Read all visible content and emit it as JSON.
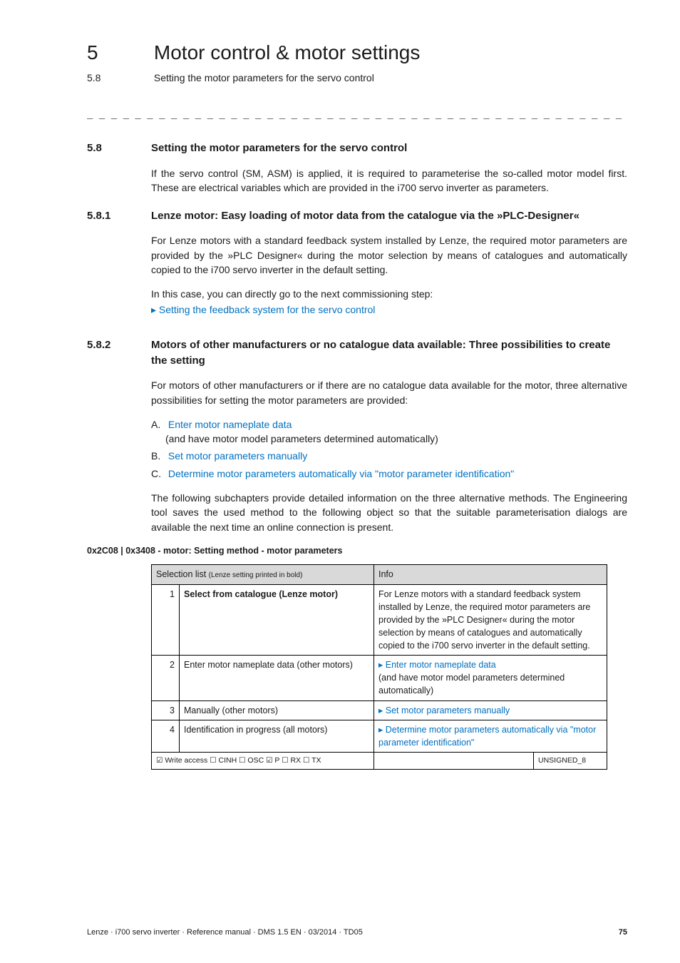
{
  "header": {
    "chapter_num": "5",
    "chapter_title": "Motor control & motor settings",
    "section_num": "5.8",
    "section_title": "Setting the motor parameters for the servo control"
  },
  "rule": "_ _ _ _ _ _ _ _ _ _ _ _ _ _ _ _ _ _ _ _ _ _ _ _ _ _ _ _ _ _ _ _ _ _ _ _ _ _ _ _ _ _ _ _ _ _ _ _ _ _ _ _ _ _ _ _ _ _ _ _ _ _ _ _",
  "s58": {
    "num": "5.8",
    "title": "Setting the motor parameters for the servo control",
    "p1": "If the servo control (SM, ASM) is applied, it is required to parameterise the so-called motor model first. These are electrical variables which are provided in the i700 servo inverter as parameters."
  },
  "s581": {
    "num": "5.8.1",
    "title": "Lenze motor: Easy loading of motor data from the catalogue via the »PLC-Designer«",
    "p1": "For Lenze motors with a standard feedback system installed by Lenze, the required motor parameters are provided by the »PLC Designer« during the motor selection by means of catalogues and automatically copied to the i700 servo inverter in the default setting.",
    "p2": "In this case, you can directly go to the next commissioning step:",
    "link": "Setting the feedback system for the servo control"
  },
  "s582": {
    "num": "5.8.2",
    "title": "Motors of other manufacturers or no catalogue data available: Three possibilities to create the setting",
    "p1": "For motors of other manufacturers or if there are no catalogue data available for the motor, three alternative possibilities for setting the motor parameters are provided:",
    "items": {
      "a_label": "A.",
      "a_link": "Enter motor nameplate data",
      "a_tail": "(and have motor model parameters determined automatically)",
      "b_label": "B.",
      "b_link": "Set motor parameters manually",
      "c_label": "C.",
      "c_link": "Determine motor parameters automatically via \"motor parameter identification\""
    },
    "p2": "The following subchapters provide detailed information on the three alternative methods. The Engineering tool saves the used method to the following object so that the suitable parameterisation dialogs are available the next time an online connection is present."
  },
  "param": {
    "title": "0x2C08 | 0x3408 - motor: Setting method - motor parameters",
    "col1": "Selection list ",
    "col1_small": "(Lenze setting printed in bold)",
    "col2": "Info",
    "rows": [
      {
        "n": "1",
        "sel": "Select from catalogue (Lenze motor)",
        "bold": true,
        "info_plain": "For Lenze motors with a standard feedback system installed by Lenze, the required motor parameters are provided by the »PLC Designer« during the motor selection by means of catalogues and automatically copied to the i700 servo inverter in the default setting."
      },
      {
        "n": "2",
        "sel": "Enter motor nameplate data (other motors)",
        "info_link": "Enter motor nameplate data",
        "info_tail": "(and have motor model parameters determined automatically)"
      },
      {
        "n": "3",
        "sel": "Manually (other motors)",
        "info_link": "Set motor parameters manually"
      },
      {
        "n": "4",
        "sel": "Identification in progress (all motors)",
        "info_link": "Determine motor parameters automatically via \"motor parameter identification\""
      }
    ],
    "footer_left": "☑ Write access   ☐ CINH   ☐ OSC   ☑ P   ☐ RX   ☐ TX",
    "footer_right": "UNSIGNED_8"
  },
  "footer": {
    "left": "Lenze · i700 servo inverter · Reference manual · DMS 1.5 EN · 03/2014 · TD05",
    "right": "75"
  }
}
